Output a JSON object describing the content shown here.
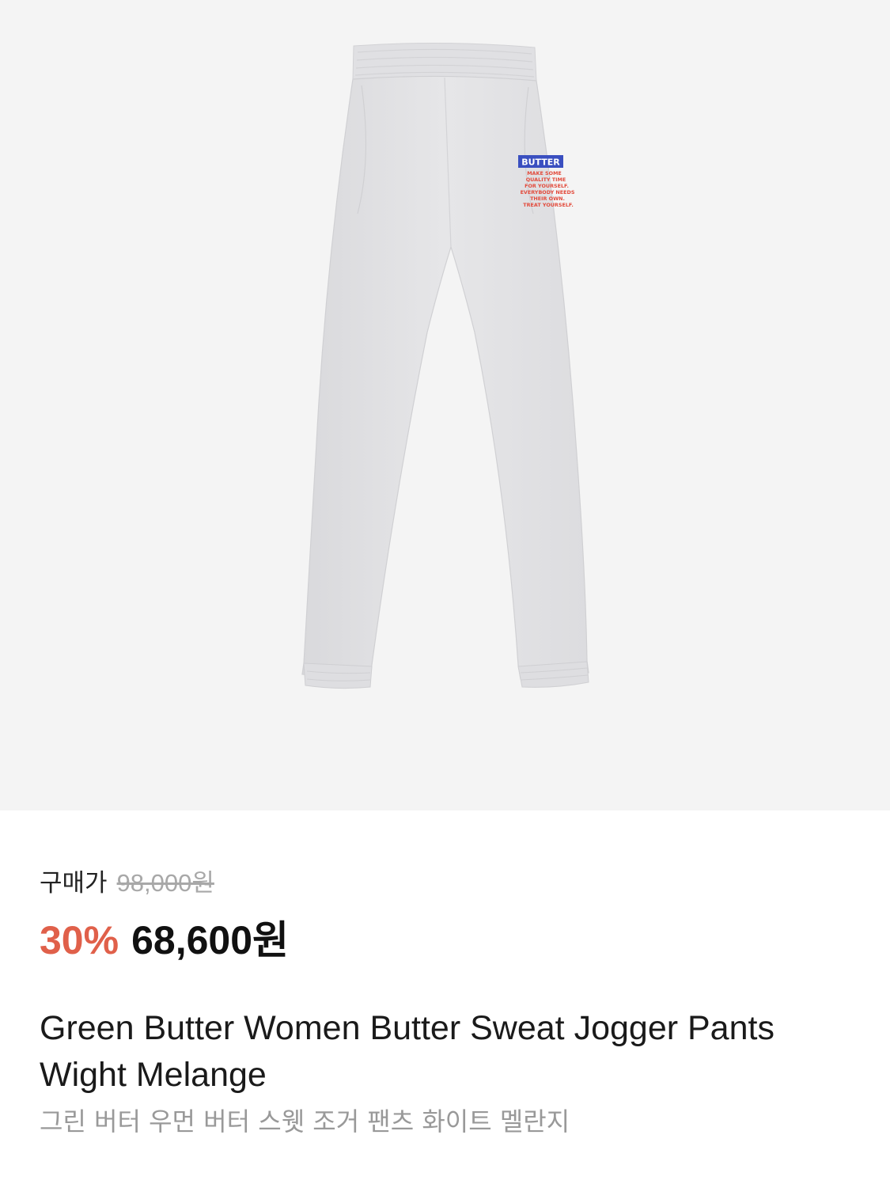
{
  "product": {
    "image_alt": "Green Butter Women Butter Sweat Jogger Pants Wight Melange",
    "logo_text": "BUTTER",
    "print_lines": [
      "MAKE SOME",
      "QUALITY TIME",
      "FOR YOURSELF.",
      "EVERYBODY NEEDS",
      "THEIR OWN.",
      "TREAT YOURSELF."
    ],
    "price_label": "구매가",
    "original_price": "98,000원",
    "discount": "30%",
    "sale_price": "68,600원",
    "title_en": "Green Butter Women Butter Sweat Jogger Pants Wight Melange",
    "title_ko": "그린 버터 우먼 버터 스웻 조거 팬츠 화이트 멜란지"
  },
  "colors": {
    "image_bg": "#f4f4f4",
    "pants": "#e3e3e5",
    "discount": "#e0604a",
    "logo_blue": "#3a4fc0",
    "print_red": "#e24a3b"
  }
}
